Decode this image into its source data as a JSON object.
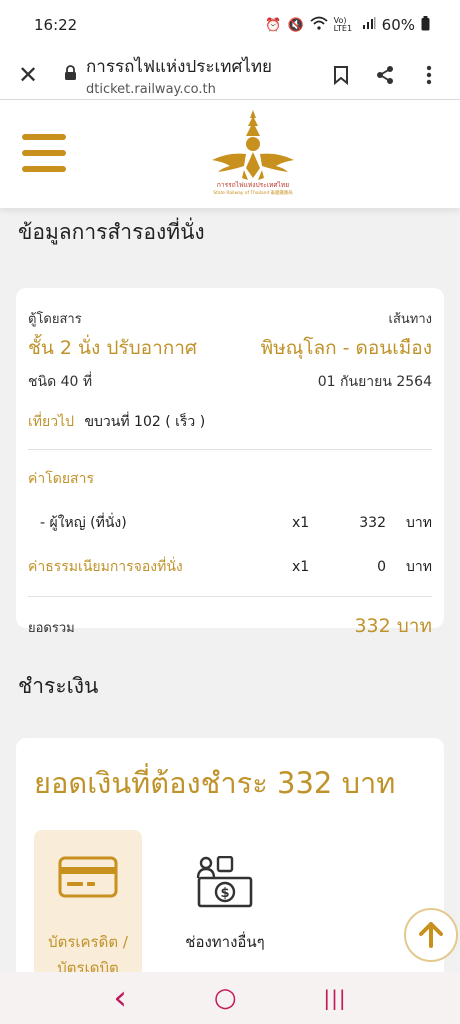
{
  "status": {
    "time": "16:22",
    "network": "Vo) LTE1",
    "battery": "60%"
  },
  "browser": {
    "title": "การรถไฟแห่งประเทศไทย",
    "domain": "dticket.railway.co.th"
  },
  "header": {
    "logo_icon": "srt-garuda-logo",
    "logo_text": "การรถไฟแห่งประเทศไทย",
    "logo_subtext": "State Railway of Thailand 泰國鐵路局"
  },
  "booking": {
    "section_title": "ข้อมูลการสำรองที่นั่ง",
    "car_label": "ตู้โดยสาร",
    "route_label": "เส้นทาง",
    "class_name": "ชั้น 2 นั่ง ปรับอากาศ",
    "route": "พิษณุโลก - ดอนเมือง",
    "train_type": "ชนิด 40 ที่",
    "date": "01 กันยายน 2564",
    "trip_label": "เที่ยวไป",
    "train_no": "ขบวนที่ 102 ( เร็ว )",
    "fare_label": "ค่าโดยสาร",
    "fares": [
      {
        "name": "- ผู้ใหญ่ (ที่นั่ง)",
        "qty": "x1",
        "amount": "332",
        "unit": "บาท"
      },
      {
        "name": "ค่าธรรมเนียมการจองที่นั่ง",
        "qty": "x1",
        "amount": "0",
        "unit": "บาท"
      }
    ],
    "total_label": "ยอดรวม",
    "total": "332 บาท"
  },
  "payment": {
    "section_title": "ชำระเงิน",
    "amount_due": "ยอดเงินที่ต้องชำระ 332 บาท",
    "options": [
      {
        "label_line1": "บัตรเครดิต /",
        "label_line2": "บัตรเดบิต",
        "icon": "credit-card-icon",
        "selected": true
      },
      {
        "label_line1": "ช่องทางอื่นๆ",
        "label_line2": "",
        "icon": "cash-payment-icon",
        "selected": false
      }
    ]
  },
  "navbar": {
    "back": "‹",
    "home": "○",
    "recents": "|||"
  },
  "colors": {
    "accent": "#c0932a",
    "selected_bg": "#f9ecd9",
    "nav_icon": "#c2185b"
  }
}
